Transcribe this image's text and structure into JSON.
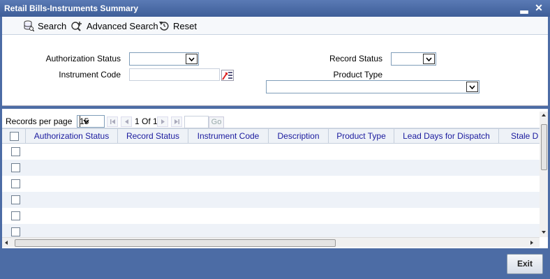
{
  "window": {
    "title": "Retail Bills-Instruments Summary",
    "minimize_glyph": "▂",
    "close_glyph": "✕"
  },
  "toolbar": {
    "search_label": "Search",
    "advanced_search_label": "Advanced Search",
    "reset_label": "Reset"
  },
  "criteria": {
    "authorization_status_label": "Authorization Status",
    "authorization_status_value": "",
    "instrument_code_label": "Instrument Code",
    "instrument_code_value": "",
    "record_status_label": "Record Status",
    "record_status_value": "",
    "product_type_label": "Product Type",
    "product_type_value": ""
  },
  "pager": {
    "records_per_page_label": "Records per page",
    "records_per_page_value": "15",
    "page_info": "1 Of 1",
    "page_input": "",
    "go_label": "Go"
  },
  "grid": {
    "columns": [
      "Authorization Status",
      "Record Status",
      "Instrument Code",
      "Description",
      "Product Type",
      "Lead Days for Dispatch",
      "Stale D"
    ],
    "rows": [
      [],
      [],
      [],
      [],
      [],
      []
    ]
  },
  "footer": {
    "exit_label": "Exit"
  },
  "colors": {
    "frame": "#4c6ca5",
    "header_text": "#1a1a9e",
    "alt_row": "#eef2f8"
  }
}
